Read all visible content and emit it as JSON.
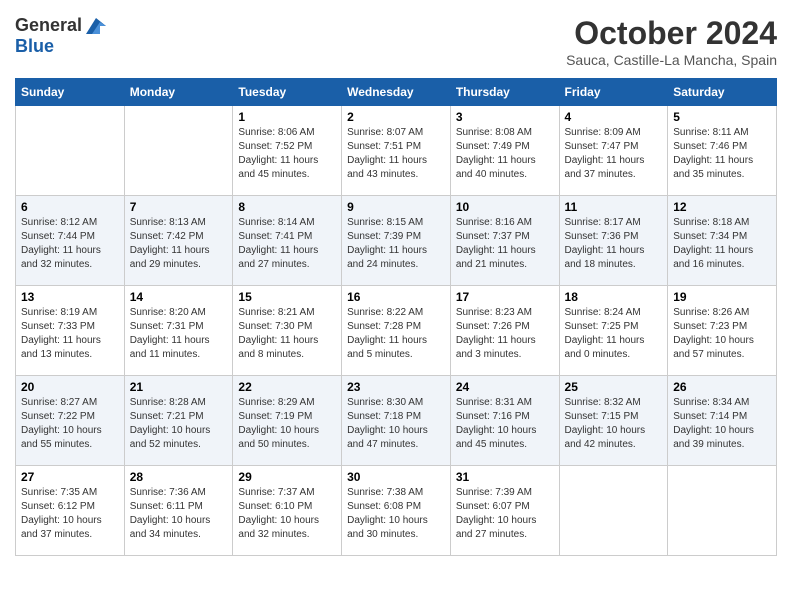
{
  "header": {
    "logo_general": "General",
    "logo_blue": "Blue",
    "month_title": "October 2024",
    "location": "Sauca, Castille-La Mancha, Spain"
  },
  "calendar": {
    "days_of_week": [
      "Sunday",
      "Monday",
      "Tuesday",
      "Wednesday",
      "Thursday",
      "Friday",
      "Saturday"
    ],
    "weeks": [
      [
        {
          "day": "",
          "info": ""
        },
        {
          "day": "",
          "info": ""
        },
        {
          "day": "1",
          "info": "Sunrise: 8:06 AM\nSunset: 7:52 PM\nDaylight: 11 hours and 45 minutes."
        },
        {
          "day": "2",
          "info": "Sunrise: 8:07 AM\nSunset: 7:51 PM\nDaylight: 11 hours and 43 minutes."
        },
        {
          "day": "3",
          "info": "Sunrise: 8:08 AM\nSunset: 7:49 PM\nDaylight: 11 hours and 40 minutes."
        },
        {
          "day": "4",
          "info": "Sunrise: 8:09 AM\nSunset: 7:47 PM\nDaylight: 11 hours and 37 minutes."
        },
        {
          "day": "5",
          "info": "Sunrise: 8:11 AM\nSunset: 7:46 PM\nDaylight: 11 hours and 35 minutes."
        }
      ],
      [
        {
          "day": "6",
          "info": "Sunrise: 8:12 AM\nSunset: 7:44 PM\nDaylight: 11 hours and 32 minutes."
        },
        {
          "day": "7",
          "info": "Sunrise: 8:13 AM\nSunset: 7:42 PM\nDaylight: 11 hours and 29 minutes."
        },
        {
          "day": "8",
          "info": "Sunrise: 8:14 AM\nSunset: 7:41 PM\nDaylight: 11 hours and 27 minutes."
        },
        {
          "day": "9",
          "info": "Sunrise: 8:15 AM\nSunset: 7:39 PM\nDaylight: 11 hours and 24 minutes."
        },
        {
          "day": "10",
          "info": "Sunrise: 8:16 AM\nSunset: 7:37 PM\nDaylight: 11 hours and 21 minutes."
        },
        {
          "day": "11",
          "info": "Sunrise: 8:17 AM\nSunset: 7:36 PM\nDaylight: 11 hours and 18 minutes."
        },
        {
          "day": "12",
          "info": "Sunrise: 8:18 AM\nSunset: 7:34 PM\nDaylight: 11 hours and 16 minutes."
        }
      ],
      [
        {
          "day": "13",
          "info": "Sunrise: 8:19 AM\nSunset: 7:33 PM\nDaylight: 11 hours and 13 minutes."
        },
        {
          "day": "14",
          "info": "Sunrise: 8:20 AM\nSunset: 7:31 PM\nDaylight: 11 hours and 11 minutes."
        },
        {
          "day": "15",
          "info": "Sunrise: 8:21 AM\nSunset: 7:30 PM\nDaylight: 11 hours and 8 minutes."
        },
        {
          "day": "16",
          "info": "Sunrise: 8:22 AM\nSunset: 7:28 PM\nDaylight: 11 hours and 5 minutes."
        },
        {
          "day": "17",
          "info": "Sunrise: 8:23 AM\nSunset: 7:26 PM\nDaylight: 11 hours and 3 minutes."
        },
        {
          "day": "18",
          "info": "Sunrise: 8:24 AM\nSunset: 7:25 PM\nDaylight: 11 hours and 0 minutes."
        },
        {
          "day": "19",
          "info": "Sunrise: 8:26 AM\nSunset: 7:23 PM\nDaylight: 10 hours and 57 minutes."
        }
      ],
      [
        {
          "day": "20",
          "info": "Sunrise: 8:27 AM\nSunset: 7:22 PM\nDaylight: 10 hours and 55 minutes."
        },
        {
          "day": "21",
          "info": "Sunrise: 8:28 AM\nSunset: 7:21 PM\nDaylight: 10 hours and 52 minutes."
        },
        {
          "day": "22",
          "info": "Sunrise: 8:29 AM\nSunset: 7:19 PM\nDaylight: 10 hours and 50 minutes."
        },
        {
          "day": "23",
          "info": "Sunrise: 8:30 AM\nSunset: 7:18 PM\nDaylight: 10 hours and 47 minutes."
        },
        {
          "day": "24",
          "info": "Sunrise: 8:31 AM\nSunset: 7:16 PM\nDaylight: 10 hours and 45 minutes."
        },
        {
          "day": "25",
          "info": "Sunrise: 8:32 AM\nSunset: 7:15 PM\nDaylight: 10 hours and 42 minutes."
        },
        {
          "day": "26",
          "info": "Sunrise: 8:34 AM\nSunset: 7:14 PM\nDaylight: 10 hours and 39 minutes."
        }
      ],
      [
        {
          "day": "27",
          "info": "Sunrise: 7:35 AM\nSunset: 6:12 PM\nDaylight: 10 hours and 37 minutes."
        },
        {
          "day": "28",
          "info": "Sunrise: 7:36 AM\nSunset: 6:11 PM\nDaylight: 10 hours and 34 minutes."
        },
        {
          "day": "29",
          "info": "Sunrise: 7:37 AM\nSunset: 6:10 PM\nDaylight: 10 hours and 32 minutes."
        },
        {
          "day": "30",
          "info": "Sunrise: 7:38 AM\nSunset: 6:08 PM\nDaylight: 10 hours and 30 minutes."
        },
        {
          "day": "31",
          "info": "Sunrise: 7:39 AM\nSunset: 6:07 PM\nDaylight: 10 hours and 27 minutes."
        },
        {
          "day": "",
          "info": ""
        },
        {
          "day": "",
          "info": ""
        }
      ]
    ]
  }
}
